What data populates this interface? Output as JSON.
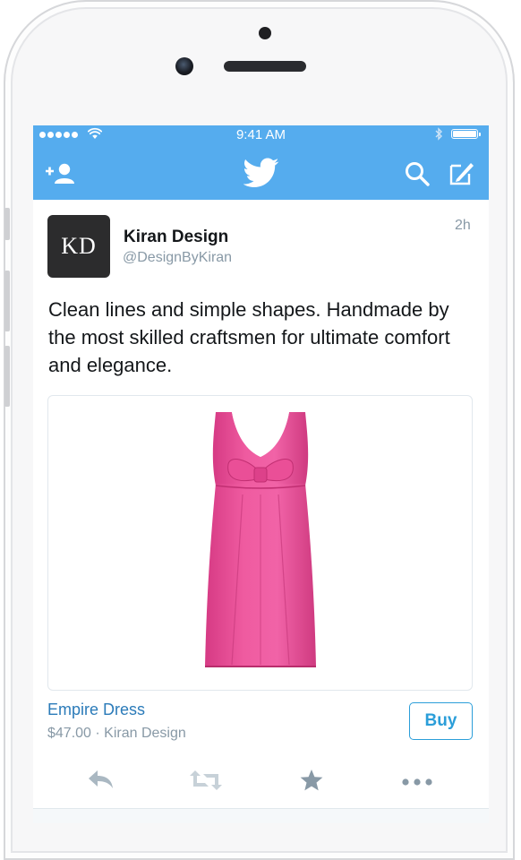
{
  "status_bar": {
    "time": "9:41 AM"
  },
  "nav_bar": {
    "icons": [
      "add-user-icon",
      "twitter-bird-icon",
      "search-icon",
      "compose-icon"
    ],
    "accent": "#55acee"
  },
  "tweet": {
    "avatar_initials": "KD",
    "display_name": "Kiran Design",
    "handle": "@DesignByKiran",
    "time_ago": "2h",
    "text": "Clean lines and simple shapes. Handmade by the most skilled craftsmen for ultimate comfort and elegance."
  },
  "product_card": {
    "image": "pink-empire-dress",
    "title": "Empire Dress",
    "price_seller": "$47.00 · Kiran Design",
    "buy_label": "Buy",
    "accent": "#2b9ed9"
  },
  "actions": [
    "reply-icon",
    "retweet-icon",
    "favorite-icon",
    "more-icon"
  ]
}
